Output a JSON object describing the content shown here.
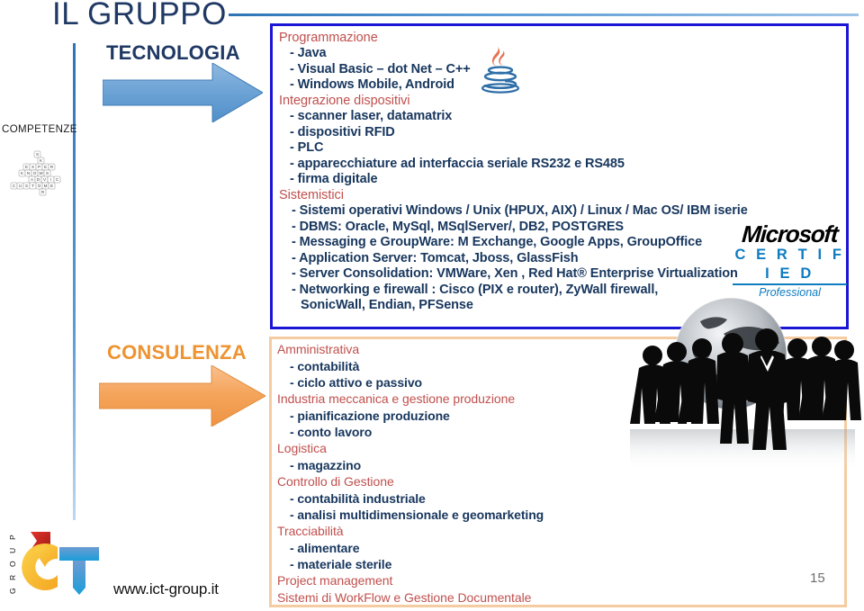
{
  "slide": {
    "title": "IL GRUPPO",
    "page_number": "15",
    "url": "www.ict-group.it",
    "left_label": "COMPETENZE",
    "colors": {
      "title": "#1F3864",
      "header_text": "#C0504D",
      "item_text": "#17365D",
      "blue_box_border": "#1B15D6",
      "orange_box_border": "#F5CBA1",
      "blue_arrow": "#5B9BD5",
      "orange_arrow": "#F5A95C",
      "consulenza_label": "#ED9331",
      "microsoft_blue": "#0F7CC0"
    }
  },
  "sections": [
    {
      "label": "TECNOLOGIA",
      "arrow_icon": "right-arrow-icon",
      "groups": [
        {
          "header": "Programmazione",
          "items": [
            "- Java",
            "- Visual Basic – dot Net – C++",
            "- Windows Mobile, Android"
          ]
        },
        {
          "header": "Integrazione dispositivi",
          "items": [
            "- scanner laser, datamatrix",
            "- dispositivi RFID",
            "- PLC",
            "- apparecchiature ad interfaccia seriale  RS232 e RS485",
            "- firma digitale"
          ]
        },
        {
          "header": "Sistemistici",
          "items": [
            "- Sistemi operativi Windows / Unix (HPUX, AIX) / Linux / Mac OS/ IBM iserie",
            "- DBMS: Oracle, MySql, MSqlServer/, DB2, POSTGRES",
            "- Messaging e GroupWare: M Exchange, Google Apps, GroupOffice",
            "- Application Server: Tomcat, Jboss, GlassFish",
            "- Server Consolidation: VMWare, Xen , Red Hat® Enterprise Virtualization",
            "- Networking e firewall : Cisco (PIX e router), ZyWall firewall,",
            "SonicWall,  Endian, PFSense"
          ]
        }
      ]
    },
    {
      "label": "CONSULENZA",
      "arrow_icon": "right-arrow-icon",
      "groups": [
        {
          "header": "Amministrativa",
          "items": [
            "- contabilità",
            "- ciclo attivo e passivo"
          ]
        },
        {
          "header": "Industria meccanica e gestione produzione",
          "items": [
            "- pianificazione produzione",
            "- conto lavoro"
          ]
        },
        {
          "header": "Logistica",
          "items": [
            "- magazzino"
          ]
        },
        {
          "header": "Controllo di Gestione",
          "items": [
            "- contabilità industriale",
            "-  analisi multidimensionale e geomarketing"
          ]
        },
        {
          "header": "Tracciabilità",
          "items": [
            "- alimentare",
            "- materiale sterile"
          ]
        },
        {
          "header": "Project management",
          "items": []
        },
        {
          "header": "Sistemi di WorkFlow e Gestione Documentale",
          "items": []
        }
      ]
    }
  ],
  "logos": {
    "java": "java-logo-icon",
    "microsoft": {
      "brand": "Microsoft",
      "certified": "C E R T I F I E D",
      "level": "Professional"
    },
    "ict": {
      "group_vertical": "G R O U P",
      "mark": "ICT"
    },
    "people": "business-people-globe-image",
    "dice": "word-dice-image"
  }
}
